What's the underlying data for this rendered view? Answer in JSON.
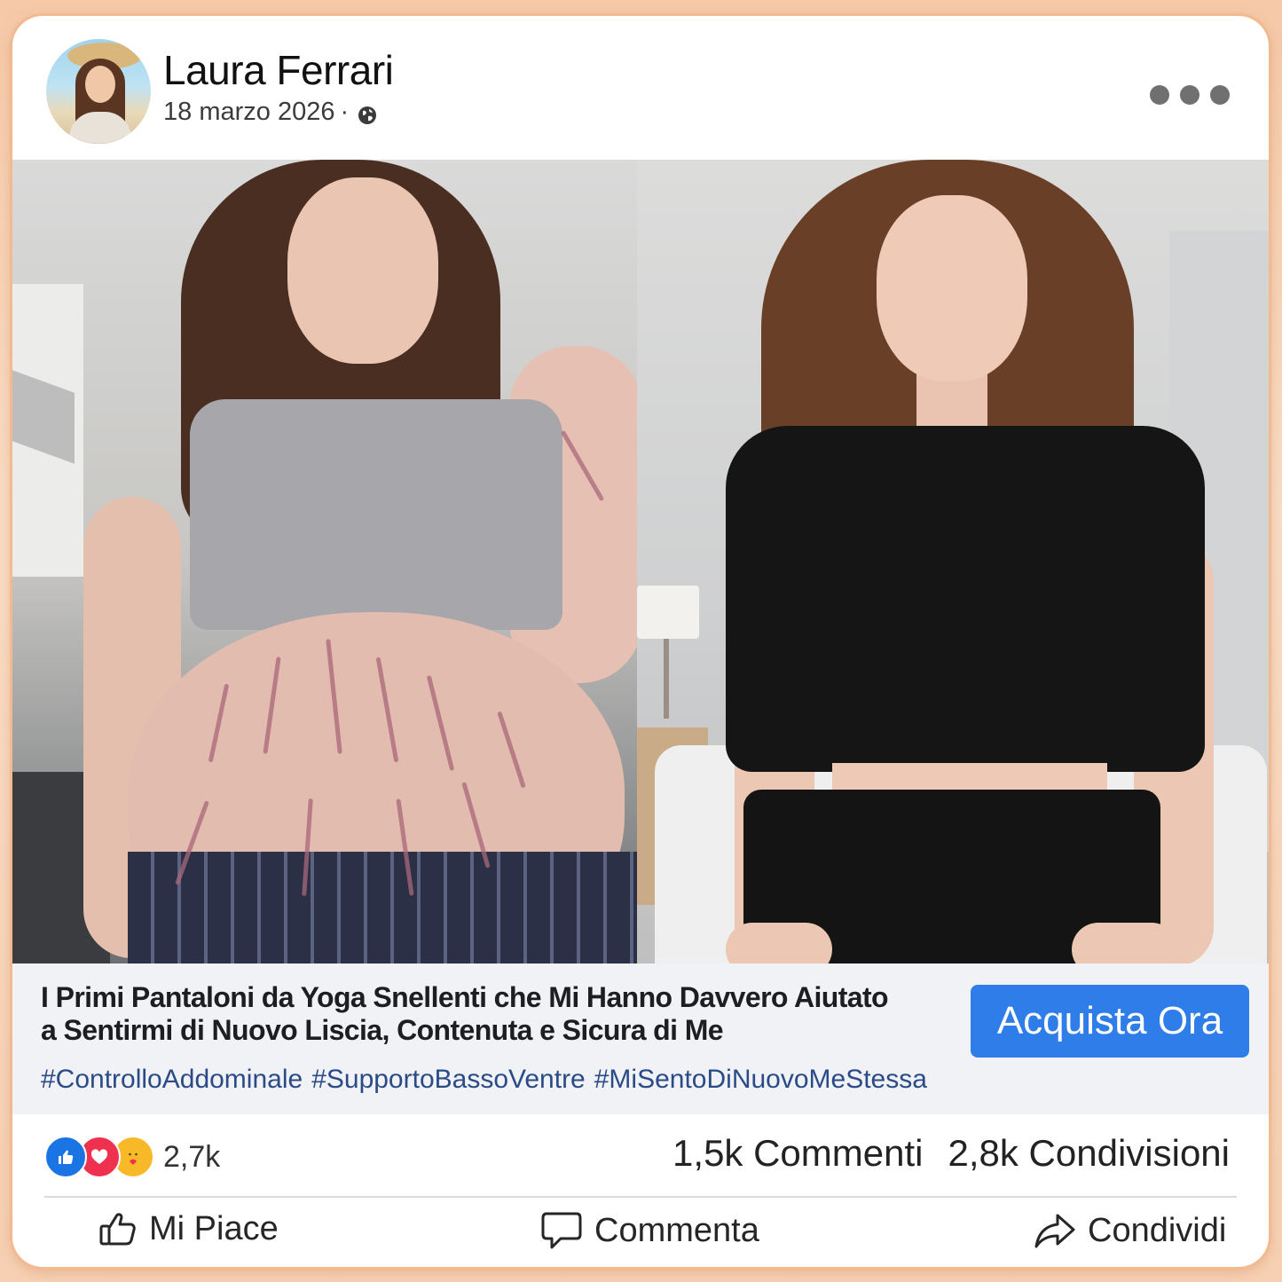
{
  "post": {
    "author": "Laura Ferrari",
    "date": "18 marzo 2026",
    "separator": "·",
    "privacy_icon": "globe-icon",
    "more_icon": "more-horizontal-icon"
  },
  "images": {
    "before": "before-photo",
    "after": "after-photo"
  },
  "ad": {
    "headline_line1": "I Primi Pantaloni da Yoga Snellenti che Mi Hanno Davvero Aiutato",
    "headline_line2": "a Sentirmi di Nuovo Liscia, Contenuta e Sicura di Me",
    "cta_label": "Acquista Ora",
    "cta_color": "#2f7de8",
    "hashtags": [
      "#ControlloAddominale",
      "#SupportoBassoVentre",
      "#MiSentoDiNuovoMeStessa"
    ]
  },
  "stats": {
    "reaction_icons": [
      "like-reaction-icon",
      "love-reaction-icon",
      "care-reaction-icon"
    ],
    "reaction_count": "2,7k",
    "comments": "1,5k Commenti",
    "shares": "2,8k Condivisioni"
  },
  "actions": {
    "like_label": "Mi Piace",
    "comment_label": "Commenta",
    "share_label": "Condividi"
  }
}
